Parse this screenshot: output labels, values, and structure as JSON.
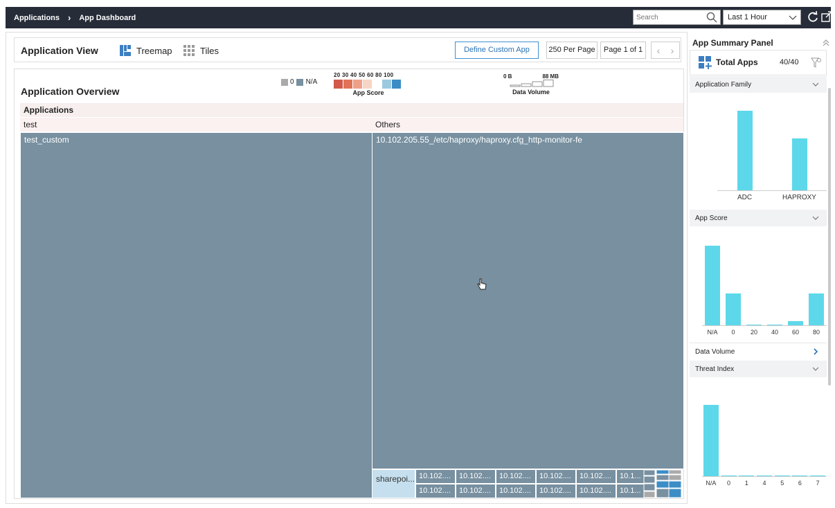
{
  "topbar": {
    "breadcrumb": [
      "Applications",
      "App Dashboard"
    ],
    "search_placeholder": "Search",
    "time_range": "Last 1 Hour"
  },
  "view": {
    "title": "Application View",
    "treemap_label": "Treemap",
    "tiles_label": "Tiles",
    "define_custom_app": "Define Custom App",
    "per_page": "250 Per Page",
    "page_info": "Page 1 of 1"
  },
  "overview": {
    "title": "Application Overview",
    "legend": {
      "zero_label": "0",
      "na_label": "N/A",
      "score_ticks": "20 30 40 50 60 80 100",
      "score_title": "App Score",
      "volume_min": "0 B",
      "volume_max": "88 MB",
      "volume_title": "Data Volume",
      "colors": [
        "#d35a4a",
        "#e07357",
        "#eea088",
        "#f6d5c6",
        "#ffffff",
        "#9dc9df",
        "#3c8dc5"
      ]
    },
    "header": "Applications",
    "groups": [
      {
        "name": "test",
        "tiles": [
          {
            "name": "test_custom"
          }
        ]
      },
      {
        "name": "Others",
        "tiles": [
          {
            "name": "10.102.205.55_/etc/haproxy/haproxy.cfg_http-monitor-fe"
          },
          {
            "name": "sharepoi..."
          }
        ]
      }
    ],
    "small_tiles": [
      "10.102....",
      "10.102....",
      "10.102....",
      "10.102....",
      "10.102....",
      "10.1...",
      "10.102....",
      "10.102....",
      "10.102....",
      "10.102....",
      "10.102....",
      "10.1..."
    ]
  },
  "summary": {
    "title": "App Summary Panel",
    "total_label": "Total Apps",
    "total_value": "40/40",
    "sections": {
      "family": "Application Family",
      "score": "App Score",
      "volume": "Data Volume",
      "threat": "Threat Index"
    }
  },
  "chart_data": [
    {
      "type": "bar",
      "title": "Application Family",
      "categories": [
        "ADC",
        "HAPROXY"
      ],
      "values": [
        32,
        21
      ]
    },
    {
      "type": "bar",
      "title": "App Score",
      "categories": [
        "N/A",
        "0",
        "20",
        "40",
        "60",
        "80"
      ],
      "values": [
        20,
        8,
        0.2,
        0.2,
        1,
        8
      ]
    },
    {
      "type": "bar",
      "title": "Threat Index",
      "categories": [
        "N/A",
        "0",
        "1",
        "4",
        "5",
        "6",
        "7"
      ],
      "values": [
        38,
        0.3,
        0.3,
        0.3,
        0.3,
        0.3,
        0.3
      ]
    }
  ]
}
